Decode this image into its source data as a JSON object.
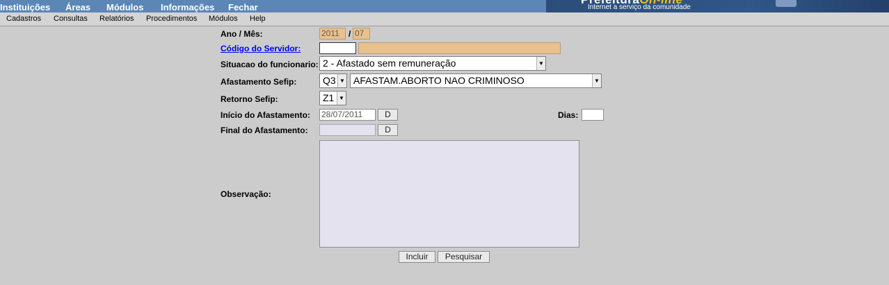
{
  "top_menu": [
    "Instituições",
    "Áreas",
    "Módulos",
    "Informações",
    "Fechar"
  ],
  "banner": {
    "title_main": "Prefeitura",
    "title_accent": "On-line",
    "tagline": "Internet a serviço da comunidade"
  },
  "sub_menu": [
    "Cadastros",
    "Consultas",
    "Relatórios",
    "Procedimentos",
    "Módulos",
    "Help"
  ],
  "form": {
    "ano_mes": {
      "label": "Ano / Mês:",
      "year": "2011",
      "separator": "/",
      "month": "07"
    },
    "servidor": {
      "label": "Código do Servidor:",
      "code": "",
      "name": ""
    },
    "situacao": {
      "label": "Situacao do funcionario:",
      "value": "2 - Afastado sem remuneração"
    },
    "afastamento_sefip": {
      "label": "Afastamento Sefip:",
      "code": "Q3",
      "description": "AFASTAM.ABORTO NAO CRIMINOSO"
    },
    "retorno_sefip": {
      "label": "Retorno Sefip:",
      "code": "Z1"
    },
    "inicio": {
      "label": "Início do Afastamento:",
      "value": "28/07/2011",
      "button": "D"
    },
    "dias": {
      "label": "Dias:",
      "value": ""
    },
    "final": {
      "label": "Final do Afastamento:",
      "value": "",
      "button": "D"
    },
    "observacao": {
      "label": "Observação:",
      "value": ""
    }
  },
  "actions": {
    "incluir": "Incluir",
    "pesquisar": "Pesquisar"
  },
  "colors": {
    "topbar": "#5b86b6",
    "banner": "#2c4d7a",
    "readonly_field": "#e8c18f",
    "lavender_field": "#e4e2ee",
    "background": "#cccccc"
  }
}
